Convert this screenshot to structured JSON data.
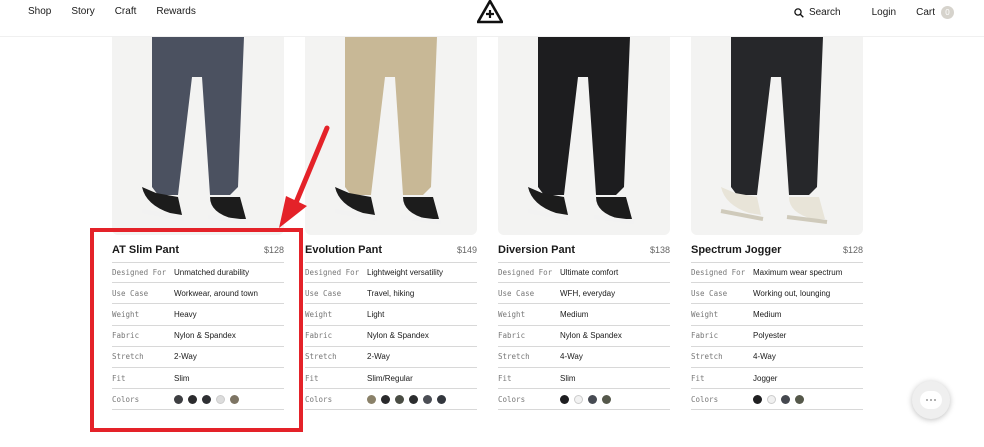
{
  "header": {
    "nav": [
      {
        "label": "Shop"
      },
      {
        "label": "Story"
      },
      {
        "label": "Craft"
      },
      {
        "label": "Rewards"
      }
    ],
    "search_label": "Search",
    "login_label": "Login",
    "cart_label": "Cart",
    "cart_count": "0"
  },
  "spec_labels": {
    "designed_for": "Designed For",
    "use_case": "Use Case",
    "weight": "Weight",
    "fabric": "Fabric",
    "stretch": "Stretch",
    "fit": "Fit",
    "colors": "Colors"
  },
  "products": [
    {
      "name": "AT Slim Pant",
      "price": "$128",
      "designed_for": "Unmatched durability",
      "use_case": "Workwear, around town",
      "weight": "Heavy",
      "fabric": "Nylon & Spandex",
      "stretch": "2-Way",
      "fit": "Slim",
      "colors": [
        "#3e3f42",
        "#2b2b2d",
        "#2e2f33",
        "#dcdcdc",
        "#7d7463"
      ],
      "pant_color": "#4b5160",
      "shoe": "dark"
    },
    {
      "name": "Evolution Pant",
      "price": "$149",
      "designed_for": "Lightweight versatility",
      "use_case": "Travel, hiking",
      "weight": "Light",
      "fabric": "Nylon & Spandex",
      "stretch": "2-Way",
      "fit": "Slim/Regular",
      "colors": [
        "#8a8169",
        "#2a2a2c",
        "#4a4d44",
        "#2b2d2e",
        "#4b4e55",
        "#33373e"
      ],
      "pant_color": "#c8b896",
      "shoe": "dark"
    },
    {
      "name": "Diversion Pant",
      "price": "$138",
      "designed_for": "Ultimate comfort",
      "use_case": "WFH, everyday",
      "weight": "Medium",
      "fabric": "Nylon & Spandex",
      "stretch": "4-Way",
      "fit": "Slim",
      "colors": [
        "#1e1e20",
        "#f2f2f2",
        "#474b53",
        "#55584b"
      ],
      "pant_color": "#1d1d1f",
      "shoe": "dark"
    },
    {
      "name": "Spectrum Jogger",
      "price": "$128",
      "designed_for": "Maximum wear spectrum",
      "use_case": "Working out, lounging",
      "weight": "Medium",
      "fabric": "Polyester",
      "stretch": "4-Way",
      "fit": "Jogger",
      "colors": [
        "#1f1f21",
        "#f0f0f0",
        "#45484f",
        "#55584a"
      ],
      "pant_color": "#26272a",
      "shoe": "light"
    }
  ],
  "accent_color": "#e42229"
}
